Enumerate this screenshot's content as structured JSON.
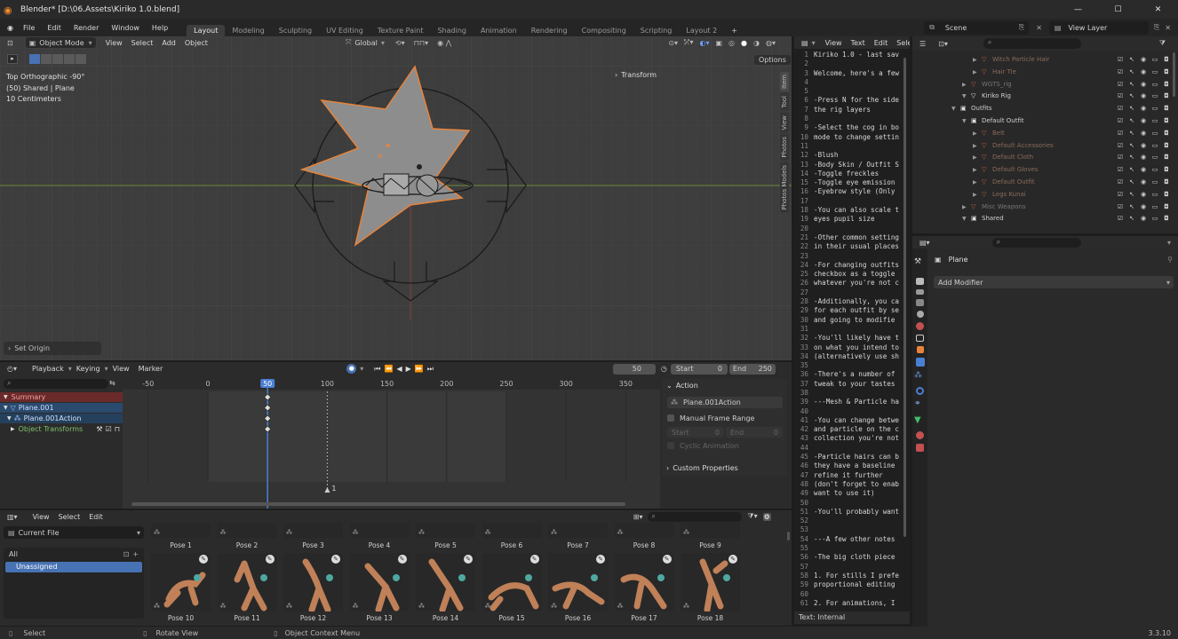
{
  "window": {
    "title": "Blender* [D:\\06.Assets\\Kiriko 1.0.blend]",
    "controls": [
      "—",
      "☐",
      "✕"
    ]
  },
  "menus": [
    "File",
    "Edit",
    "Render",
    "Window",
    "Help"
  ],
  "workspaces": [
    "Layout",
    "Modeling",
    "Sculpting",
    "UV Editing",
    "Texture Paint",
    "Shading",
    "Animation",
    "Rendering",
    "Compositing",
    "Scripting",
    "Layout 2"
  ],
  "workspace_add": "+",
  "scene": {
    "label": "Scene",
    "view_layer": "View Layer"
  },
  "viewport": {
    "mode": "Object Mode",
    "menus": [
      "View",
      "Select",
      "Add",
      "Object"
    ],
    "orientation": "Global",
    "options": "Options",
    "info": [
      "Top Orthographic -90°",
      "(50) Shared | Plane",
      "10 Centimeters"
    ],
    "transform": "Transform",
    "side_tabs": [
      "Item",
      "Tool",
      "View",
      "Photos",
      "Photos Models"
    ],
    "last_op": "Set Origin"
  },
  "text_editor": {
    "menus": [
      "View",
      "Text",
      "Edit",
      "Sele"
    ],
    "footer": "Text: Internal",
    "lines": [
      {
        "n": "1",
        "t": "Kiriko 1.0 - last sav"
      },
      {
        "n": "2",
        "t": ""
      },
      {
        "n": "3",
        "t": "Welcome, here's a few"
      },
      {
        "n": "4",
        "t": ""
      },
      {
        "n": "5",
        "t": ""
      },
      {
        "n": "6",
        "t": "-Press N for the side"
      },
      {
        "n": "7",
        "t": "the rig layers"
      },
      {
        "n": "8",
        "t": ""
      },
      {
        "n": "9",
        "t": "-Select the cog in bo"
      },
      {
        "n": "10",
        "t": "mode to change settin"
      },
      {
        "n": "11",
        "t": ""
      },
      {
        "n": "12",
        "t": "-Blush"
      },
      {
        "n": "13",
        "t": "-Body Skin / Outfit S"
      },
      {
        "n": "14",
        "t": "-Toggle freckles"
      },
      {
        "n": "15",
        "t": "-Toggle eye emission"
      },
      {
        "n": "16",
        "t": "-Eyebrow style (Only"
      },
      {
        "n": "17",
        "t": ""
      },
      {
        "n": "18",
        "t": "-You can also scale t"
      },
      {
        "n": "19",
        "t": "eyes pupil size"
      },
      {
        "n": "20",
        "t": ""
      },
      {
        "n": "21",
        "t": "-Other common setting"
      },
      {
        "n": "22",
        "t": "in their usual places"
      },
      {
        "n": "23",
        "t": ""
      },
      {
        "n": "24",
        "t": "-For changing outfits"
      },
      {
        "n": "25",
        "t": "checkbox as a toggle"
      },
      {
        "n": "26",
        "t": "whatever you're not c"
      },
      {
        "n": "27",
        "t": ""
      },
      {
        "n": "28",
        "t": "-Additionally, you ca"
      },
      {
        "n": "29",
        "t": "for each outfit by se"
      },
      {
        "n": "30",
        "t": "and going to modifie"
      },
      {
        "n": "31",
        "t": ""
      },
      {
        "n": "32",
        "t": "-You'll likely have t"
      },
      {
        "n": "33",
        "t": "on what you intend to"
      },
      {
        "n": "34",
        "t": "(alternatively use sh"
      },
      {
        "n": "35",
        "t": ""
      },
      {
        "n": "36",
        "t": "-There's a number of"
      },
      {
        "n": "37",
        "t": "tweak to your tastes"
      },
      {
        "n": "38",
        "t": ""
      },
      {
        "n": "39",
        "t": "---Mesh & Particle ha"
      },
      {
        "n": "40",
        "t": ""
      },
      {
        "n": "41",
        "t": "-You can change betwe"
      },
      {
        "n": "42",
        "t": "and particle on the c"
      },
      {
        "n": "43",
        "t": "collection you're not"
      },
      {
        "n": "44",
        "t": ""
      },
      {
        "n": "45",
        "t": "-Particle hairs can b"
      },
      {
        "n": "46",
        "t": "they have a baseline"
      },
      {
        "n": "47",
        "t": "refine it further"
      },
      {
        "n": "48",
        "t": "(don't forget to enab"
      },
      {
        "n": "49",
        "t": "want to use it)"
      },
      {
        "n": "50",
        "t": ""
      },
      {
        "n": "51",
        "t": "-You'll probably want"
      },
      {
        "n": "52",
        "t": ""
      },
      {
        "n": "53",
        "t": ""
      },
      {
        "n": "54",
        "t": "---A few other notes"
      },
      {
        "n": "55",
        "t": ""
      },
      {
        "n": "56",
        "t": "-The big cloth piece"
      },
      {
        "n": "57",
        "t": ""
      },
      {
        "n": "58",
        "t": "1. For stills I prefe"
      },
      {
        "n": "59",
        "t": "proportional editing"
      },
      {
        "n": "60",
        "t": ""
      },
      {
        "n": "61",
        "t": "2. For animations, I"
      }
    ]
  },
  "outliner": {
    "rows": [
      {
        "ind": 2,
        "label": "Witch Particle Hair",
        "col": "#8a6a5a",
        "dim": true
      },
      {
        "ind": 2,
        "label": "Hair Tie",
        "col": "#8a6a5a",
        "dim": true
      },
      {
        "ind": 1,
        "label": "WGTS_rig",
        "col": "#777",
        "dim": true
      },
      {
        "ind": 1,
        "label": "Kiriko Rig",
        "col": "#d0d0d0",
        "dim": false
      },
      {
        "ind": 0,
        "label": "Outfits",
        "col": "#d0d0d0",
        "dim": false
      },
      {
        "ind": 1,
        "label": "Default Outfit",
        "col": "#d0d0d0",
        "dim": false
      },
      {
        "ind": 2,
        "label": "Belt",
        "col": "#8a6a5a",
        "dim": true
      },
      {
        "ind": 2,
        "label": "Default Accessories",
        "col": "#8a6a5a",
        "dim": true
      },
      {
        "ind": 2,
        "label": "Default Cloth",
        "col": "#8a6a5a",
        "dim": true
      },
      {
        "ind": 2,
        "label": "Default Gloves",
        "col": "#8a6a5a",
        "dim": true
      },
      {
        "ind": 2,
        "label": "Default Outfit",
        "col": "#8a6a5a",
        "dim": true
      },
      {
        "ind": 2,
        "label": "Legs Kunai",
        "col": "#8a6a5a",
        "dim": true
      },
      {
        "ind": 1,
        "label": "Misc Weapons",
        "col": "#777",
        "dim": true
      },
      {
        "ind": 1,
        "label": "Shared",
        "col": "#d0d0d0",
        "dim": false
      }
    ]
  },
  "properties": {
    "object": "Plane",
    "add_modifier": "Add Modifier"
  },
  "timeline": {
    "menus": [
      "Playback",
      "Keying",
      "View",
      "Marker"
    ],
    "current_frame": "50",
    "start_label": "Start",
    "start": "0",
    "end_label": "End",
    "end": "250",
    "ticks": [
      "-50",
      "0",
      "50",
      "100",
      "150",
      "200",
      "250",
      "300",
      "350"
    ],
    "channels": [
      "Summary",
      "Plane.001",
      "Plane.001Action",
      "Object Transforms"
    ],
    "marker": "1"
  },
  "action_panel": {
    "title": "Action",
    "action_name": "Plane.001Action",
    "manual_range": "Manual Frame Range",
    "start_label": "Start",
    "start": "0",
    "end_label": "End",
    "end": "0",
    "cyclic": "Cyclic Animation",
    "custom": "Custom Properties"
  },
  "asset_browser": {
    "menus": [
      "View",
      "Select",
      "Edit"
    ],
    "library": "Current File",
    "catalog_all": "All",
    "catalog_unassigned": "Unassigned",
    "row1": [
      "Pose 1",
      "Pose 2",
      "Pose 3",
      "Pose 4",
      "Pose 5",
      "Pose 6",
      "Pose 7",
      "Pose 8",
      "Pose 9"
    ],
    "row2": [
      "Pose 10",
      "Pose 11",
      "Pose 12",
      "Pose 13",
      "Pose 14",
      "Pose 15",
      "Pose 16",
      "Pose 17",
      "Pose 18"
    ]
  },
  "statusbar": {
    "select": "Select",
    "rotate": "Rotate View",
    "context": "Object Context Menu",
    "version": "3.3.10"
  },
  "colors": {
    "accent": "#4772b3",
    "timeline_cursor": "#4a7fd4",
    "selection": "#e8833a",
    "summary_bg": "#6b2a2a",
    "channel_bg": "#2a4a6e"
  }
}
